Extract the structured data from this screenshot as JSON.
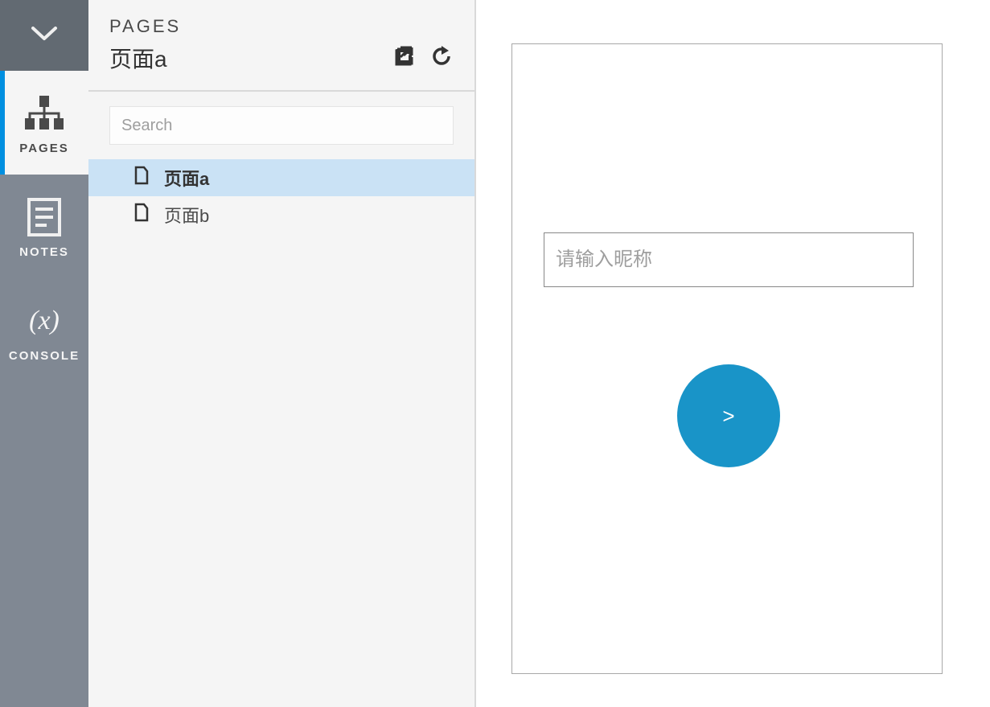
{
  "nav": {
    "tabs": [
      {
        "id": "pages",
        "label": "PAGES",
        "active": true
      },
      {
        "id": "notes",
        "label": "NOTES",
        "active": false
      },
      {
        "id": "console",
        "label": "CONSOLE",
        "active": false
      }
    ],
    "console_glyph": "(x)"
  },
  "sidebar": {
    "title": "PAGES",
    "current_page": "页面a",
    "search_placeholder": "Search",
    "pages": [
      {
        "name": "页面a",
        "selected": true
      },
      {
        "name": "页面b",
        "selected": false
      }
    ]
  },
  "canvas": {
    "nickname_placeholder": "请输入昵称",
    "next_button_label": ">"
  },
  "colors": {
    "accent": "#008fe0",
    "button": "#1994c8",
    "rail": "#808893",
    "rail_dark": "#626a72"
  }
}
